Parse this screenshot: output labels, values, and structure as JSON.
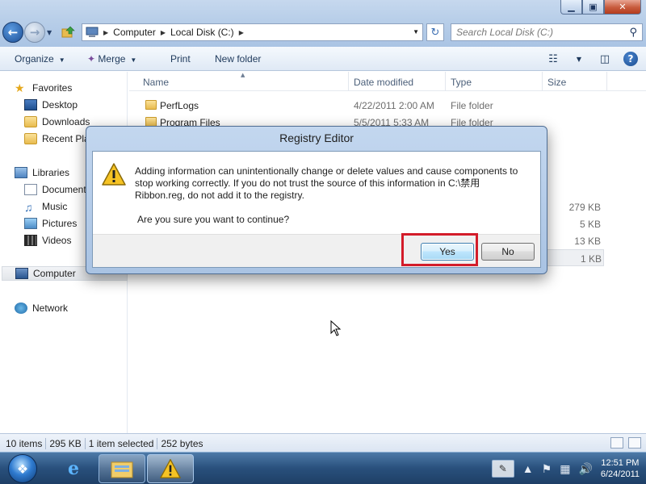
{
  "window": {
    "controls": {
      "minimize": "▁",
      "maximize": "▣",
      "close": "✕"
    }
  },
  "address_bar": {
    "crumbs": [
      "Computer",
      "Local Disk (C:)"
    ],
    "search_placeholder": "Search Local Disk (C:)"
  },
  "command_bar": {
    "organize": "Organize",
    "merge": "Merge",
    "print": "Print",
    "new_folder": "New folder"
  },
  "nav_pane": {
    "favorites": "Favorites",
    "desktop": "Desktop",
    "downloads": "Downloads",
    "recent_places": "Recent Pla",
    "libraries": "Libraries",
    "documents": "Document",
    "music": "Music",
    "pictures": "Pictures",
    "videos": "Videos",
    "computer": "Computer",
    "network": "Network"
  },
  "file_list": {
    "columns": {
      "name": "Name",
      "date": "Date modified",
      "type": "Type",
      "size": "Size"
    },
    "rows": [
      {
        "name": "PerfLogs",
        "date": "4/22/2011 2:00 AM",
        "type": "File folder",
        "size": ""
      },
      {
        "name": "Program Files",
        "date": "5/5/2011 5:33 AM",
        "type": "File folder",
        "size": ""
      },
      {
        "name": "",
        "date": "",
        "type": "",
        "size": "279 KB"
      },
      {
        "name": "",
        "date": "",
        "type": "",
        "size": "5 KB"
      },
      {
        "name": "",
        "date": "",
        "type": "",
        "size": "13 KB"
      },
      {
        "name": "",
        "date": "",
        "type": "",
        "size": "1 KB"
      }
    ]
  },
  "dialog": {
    "title": "Registry Editor",
    "message": "Adding information can unintentionally change or delete values and cause components to stop working correctly. If you do not trust the source of this information in C:\\禁用 Ribbon.reg, do not add it to the registry.",
    "question": "Are you sure you want to continue?",
    "yes": "Yes",
    "no": "No",
    "highlight_color": "#d31c2a"
  },
  "status_bar": {
    "items": "10 items",
    "size": "295 KB",
    "selected": "1 item selected",
    "selected_size": "252 bytes"
  },
  "taskbar": {
    "time": "12:51 PM",
    "date": "6/24/2011"
  }
}
